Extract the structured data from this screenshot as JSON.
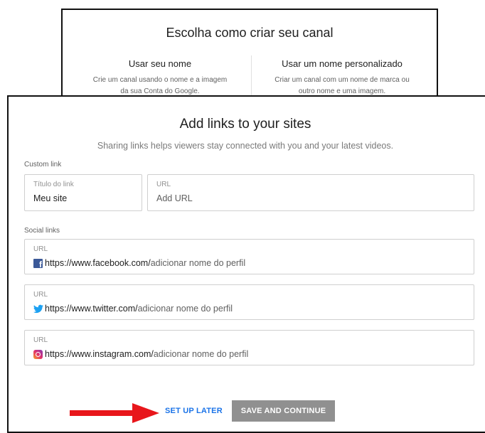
{
  "channel_chooser": {
    "title": "Escolha como criar seu canal",
    "option_name": {
      "title": "Usar seu nome",
      "desc_line1": "Crie um canal usando o nome e a imagem",
      "desc_line2": "da sua Conta do Google."
    },
    "option_custom": {
      "title": "Usar um nome personalizado",
      "desc_line1": "Criar um canal com um nome de marca ou",
      "desc_line2": "outro nome e uma imagem."
    }
  },
  "links_dialog": {
    "title": "Add links to your sites",
    "subtitle": "Sharing links helps viewers stay connected with you and your latest videos.",
    "custom_link": {
      "section_label": "Custom link",
      "title_field": {
        "label": "Título do link",
        "value": "Meu site"
      },
      "url_field": {
        "label": "URL",
        "placeholder": "Add URL"
      }
    },
    "social_links": {
      "section_label": "Social links",
      "items": [
        {
          "label": "URL",
          "icon": "facebook-icon",
          "prefix": "https://www.facebook.com/",
          "placeholder": "adicionar nome do perfil"
        },
        {
          "label": "URL",
          "icon": "twitter-icon",
          "prefix": "https://www.twitter.com/",
          "placeholder": "adicionar nome do perfil"
        },
        {
          "label": "URL",
          "icon": "instagram-icon",
          "prefix": "https://www.instagram.com/",
          "placeholder": "adicionar nome do perfil"
        }
      ]
    },
    "actions": {
      "later_label": "SET UP LATER",
      "save_label": "SAVE AND CONTINUE"
    }
  },
  "colors": {
    "accent_blue": "#1a73e8",
    "arrow_red": "#e8161b",
    "button_disabled_gray": "#909090"
  }
}
